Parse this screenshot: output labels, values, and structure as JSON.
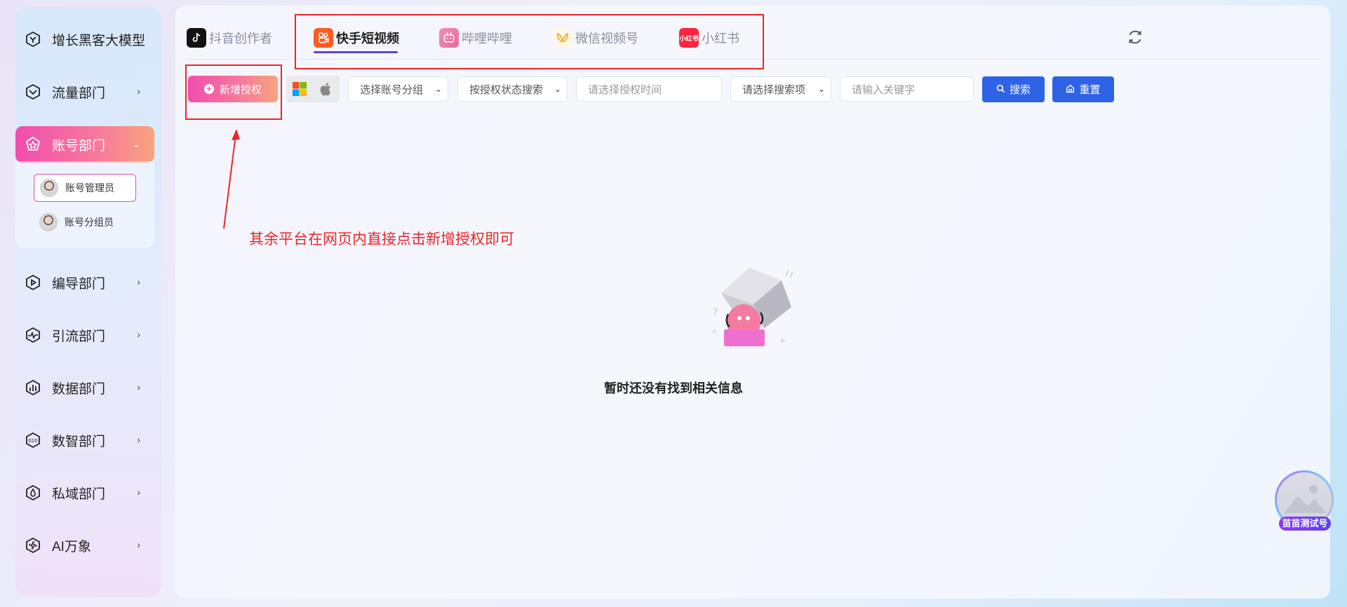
{
  "sidebar": {
    "items": [
      {
        "label": "增长黑客大模型",
        "icon": "hexagon-icon"
      },
      {
        "label": "流量部门",
        "icon": "heart-shield-icon"
      },
      {
        "label": "账号部门",
        "icon": "pentagon-star-icon"
      },
      {
        "label": "编导部门",
        "icon": "play-hexagon-icon"
      },
      {
        "label": "引流部门",
        "icon": "pulse-icon"
      },
      {
        "label": "数据部门",
        "icon": "bar-chart-icon"
      },
      {
        "label": "数智部门",
        "icon": "binary-icon"
      },
      {
        "label": "私域部门",
        "icon": "drop-icon"
      },
      {
        "label": "AI万象",
        "icon": "fan-icon"
      }
    ],
    "sub_items": [
      {
        "label": "账号管理员"
      },
      {
        "label": "账号分组员"
      }
    ]
  },
  "tabs": [
    {
      "label": "抖音创作者",
      "icon": "tiktok-icon",
      "color": "#111111"
    },
    {
      "label": "快手短视频",
      "icon": "kuaishou-icon",
      "color": "#ff5a1f"
    },
    {
      "label": "哔哩哔哩",
      "icon": "bilibili-icon",
      "color": "#f07aa0"
    },
    {
      "label": "微信视频号",
      "icon": "wechat-channels-icon",
      "color": "#f5a623"
    },
    {
      "label": "小红书",
      "icon": "xiaohongshu-icon",
      "color": "#ff2442",
      "icon_text": "小红书"
    }
  ],
  "toolbar": {
    "add_label": "新增授权",
    "account_group_select": "选择账号分组",
    "auth_status_select": "按授权状态搜索",
    "auth_time_placeholder": "请选择授权时间",
    "search_item_select": "请选择搜索项",
    "keyword_placeholder": "请输入关键字",
    "search_label": "搜索",
    "reset_label": "重置"
  },
  "annotation": {
    "note": "其余平台在网页内直接点击新增授权即可"
  },
  "empty_state": {
    "message": "暂时还没有找到相关信息"
  },
  "floating": {
    "label": "苗苗测试号"
  },
  "colors": {
    "accent_gradient_start": "#f24cae",
    "accent_gradient_end": "#f9a37c",
    "primary_blue": "#2f63e6",
    "annotation_red": "#e8282b",
    "tab_underline": "#5a46d6"
  }
}
